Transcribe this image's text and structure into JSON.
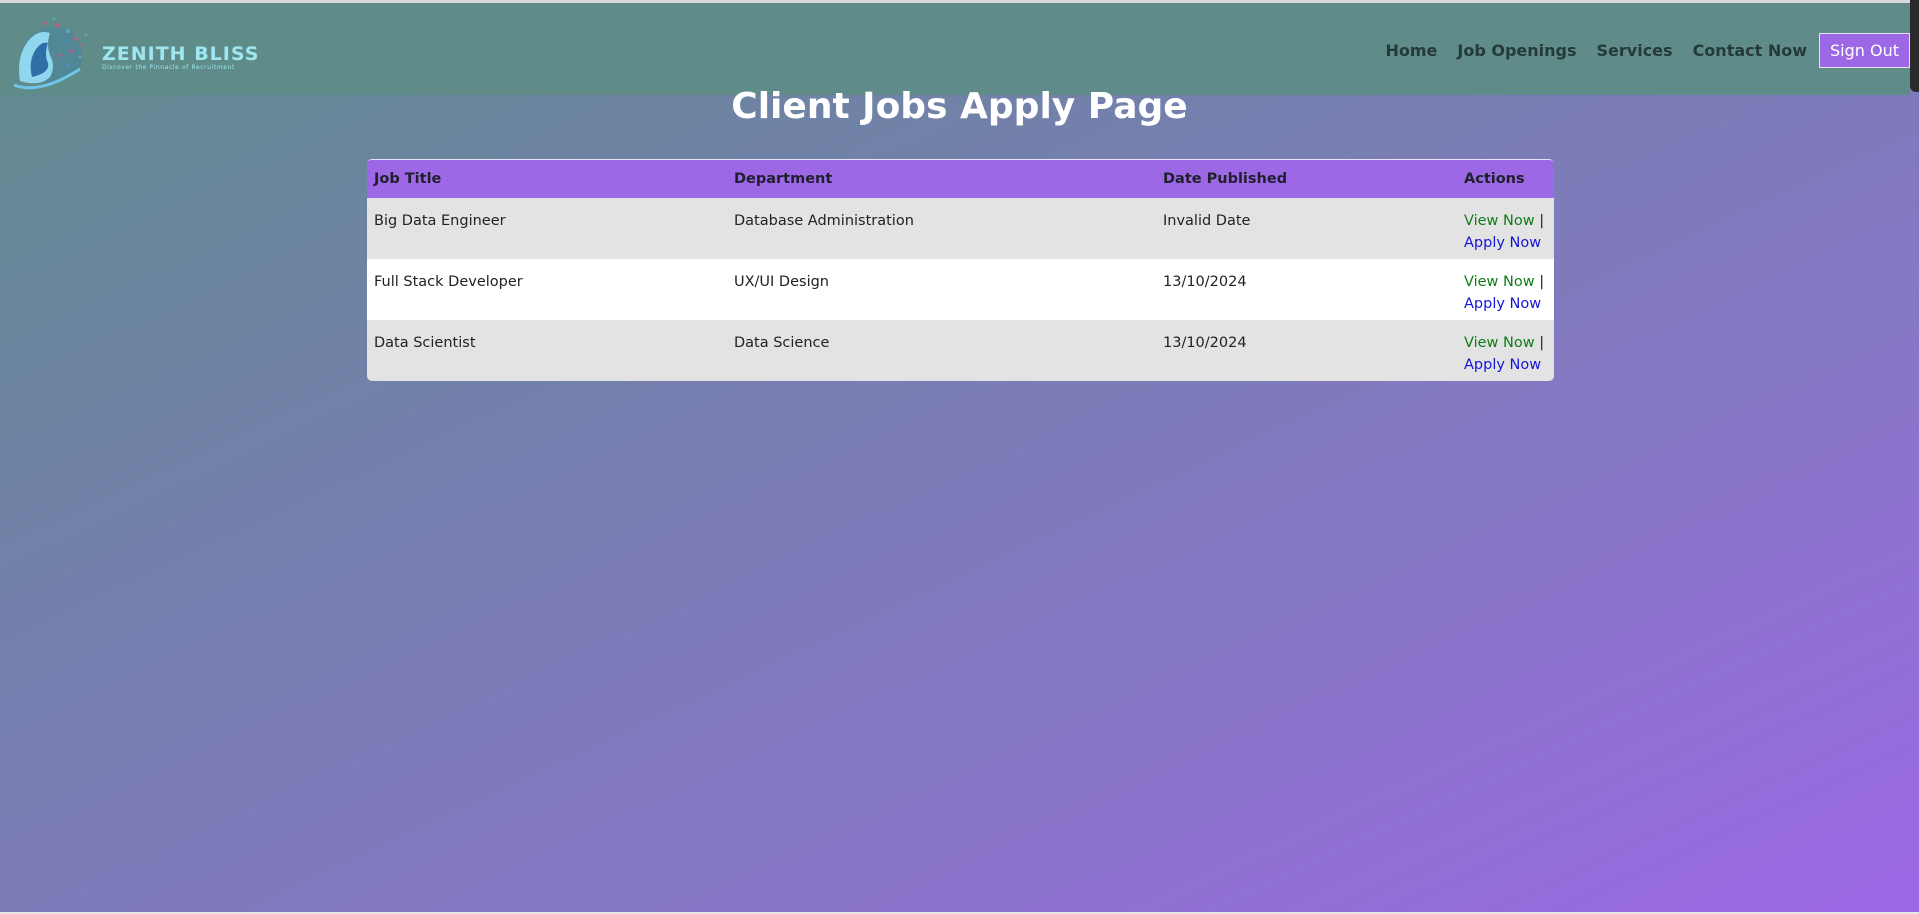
{
  "brand": {
    "name": "ZENITH BLISS",
    "tagline": "Discover the Pinnacle of Recruitment"
  },
  "nav": {
    "items": [
      "Home",
      "Job Openings",
      "Services",
      "Contact Now"
    ],
    "signout_label": "Sign Out"
  },
  "page": {
    "title": "Client Jobs Apply Page"
  },
  "table": {
    "headers": [
      "Job Title",
      "Department",
      "Date Published",
      "Actions"
    ],
    "rows": [
      {
        "title": "Big Data Engineer",
        "department": "Database Administration",
        "date": "Invalid Date"
      },
      {
        "title": "Full Stack Developer",
        "department": "UX/UI Design",
        "date": "13/10/2024"
      },
      {
        "title": "Data Scientist",
        "department": "Data Science",
        "date": "13/10/2024"
      }
    ],
    "view_label": "View Now",
    "separator": "|",
    "apply_label": "Apply Now"
  },
  "colors": {
    "header_bg": "#5f8c88",
    "accent": "#9d68e6",
    "view_link": "#0e7d16",
    "apply_link": "#1515d6"
  },
  "icons": {
    "logo": "brain-network-head-logo"
  }
}
